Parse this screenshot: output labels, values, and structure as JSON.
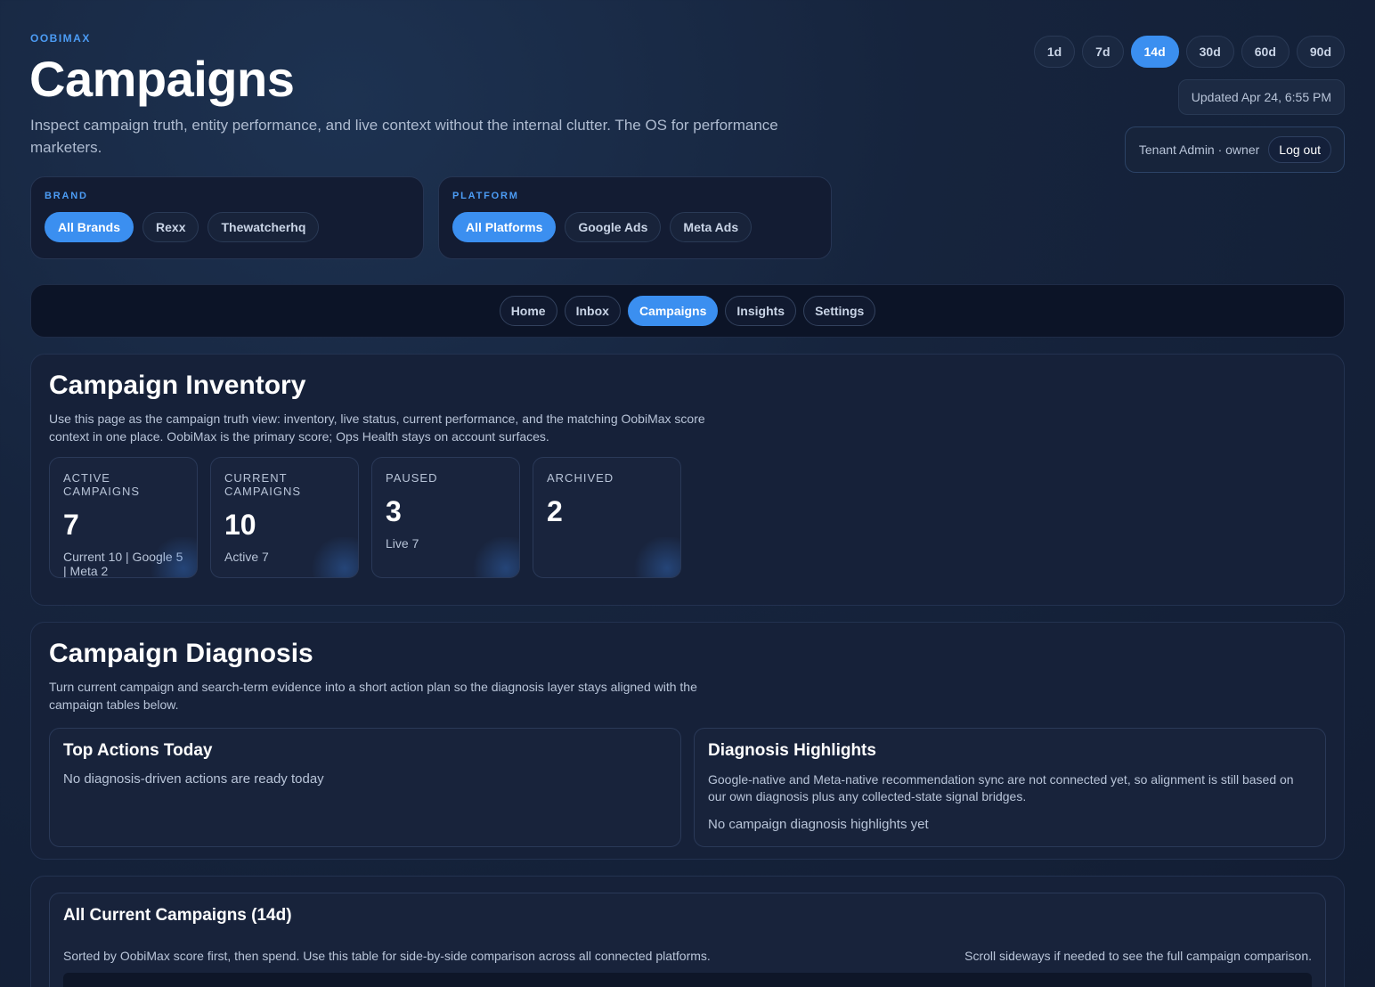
{
  "header": {
    "brand": "OOBIMAX",
    "title": "Campaigns",
    "subtitle": "Inspect campaign truth, entity performance, and live context without the internal clutter. The OS for performance marketers."
  },
  "date_ranges": [
    "1d",
    "7d",
    "14d",
    "30d",
    "60d",
    "90d"
  ],
  "date_range_selected": "14d",
  "updated": "Updated Apr 24, 6:55 PM",
  "user": {
    "label": "Tenant Admin · owner",
    "logout": "Log out"
  },
  "brand_filter": {
    "label": "BRAND",
    "options": [
      "All Brands",
      "Rexx",
      "Thewatcherhq"
    ],
    "selected": "All Brands"
  },
  "platform_filter": {
    "label": "PLATFORM",
    "options": [
      "All Platforms",
      "Google Ads",
      "Meta Ads"
    ],
    "selected": "All Platforms"
  },
  "nav": {
    "tabs": [
      "Home",
      "Inbox",
      "Campaigns",
      "Insights",
      "Settings"
    ],
    "active": "Campaigns"
  },
  "inventory": {
    "title": "Campaign Inventory",
    "desc": "Use this page as the campaign truth view: inventory, live status, current performance, and the matching OobiMax score context in one place. OobiMax is the primary score; Ops Health stays on account surfaces.",
    "stats": [
      {
        "label": "ACTIVE CAMPAIGNS",
        "value": "7",
        "sub": "Current 10 | Google 5 | Meta 2"
      },
      {
        "label": "CURRENT CAMPAIGNS",
        "value": "10",
        "sub": "Active 7"
      },
      {
        "label": "PAUSED",
        "value": "3",
        "sub": "Live 7"
      },
      {
        "label": "ARCHIVED",
        "value": "2",
        "sub": ""
      }
    ]
  },
  "diagnosis": {
    "title": "Campaign Diagnosis",
    "desc": "Turn current campaign and search-term evidence into a short action plan so the diagnosis layer stays aligned with the campaign tables below.",
    "actions": {
      "title": "Top Actions Today",
      "empty": "No diagnosis-driven actions are ready today"
    },
    "highlights": {
      "title": "Diagnosis Highlights",
      "text": "Google-native and Meta-native recommendation sync are not connected yet, so alignment is still based on our own diagnosis plus any collected-state signal bridges.",
      "empty": "No campaign diagnosis highlights yet"
    }
  },
  "current_table": {
    "title": "All Current Campaigns (14d)",
    "sub_left": "Sorted by OobiMax score first, then spend. Use this table for side-by-side comparison across all connected platforms.",
    "sub_right": "Scroll sideways if needed to see the full campaign comparison."
  }
}
